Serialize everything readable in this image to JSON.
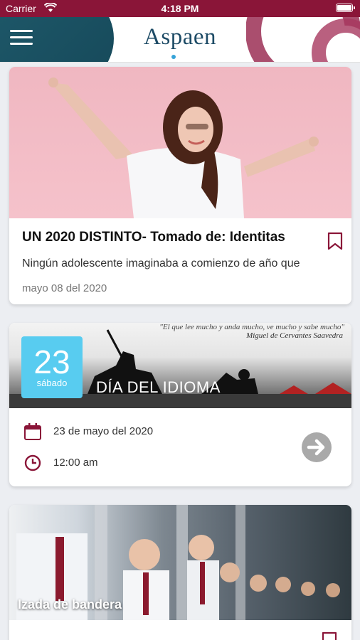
{
  "status_bar": {
    "carrier": "Carrier",
    "time": "4:18 PM"
  },
  "header": {
    "logo_text": "Aspaen"
  },
  "news_card": {
    "title": "UN 2020 DISTINTO- Tomado de: Identitas",
    "description": "Ningún adolescente imaginaba a comienzo de año que",
    "date": "mayo 08 del 2020"
  },
  "event_card": {
    "quote": "\"El que lee mucho y anda mucho, ve mucho y sabe mucho\"",
    "quote_author": "Miguel de Cervantes Saavedra",
    "badge_day": "23",
    "badge_weekday": "sábado",
    "title": "DÍA DEL IDIOMA",
    "date": "23 de mayo del 2020",
    "time": "12:00 am"
  },
  "photo_card": {
    "label": "Izada de bandera"
  },
  "colors": {
    "brand": "#8a1538",
    "teal": "#1f5a6b",
    "badge": "#58ccf0"
  }
}
